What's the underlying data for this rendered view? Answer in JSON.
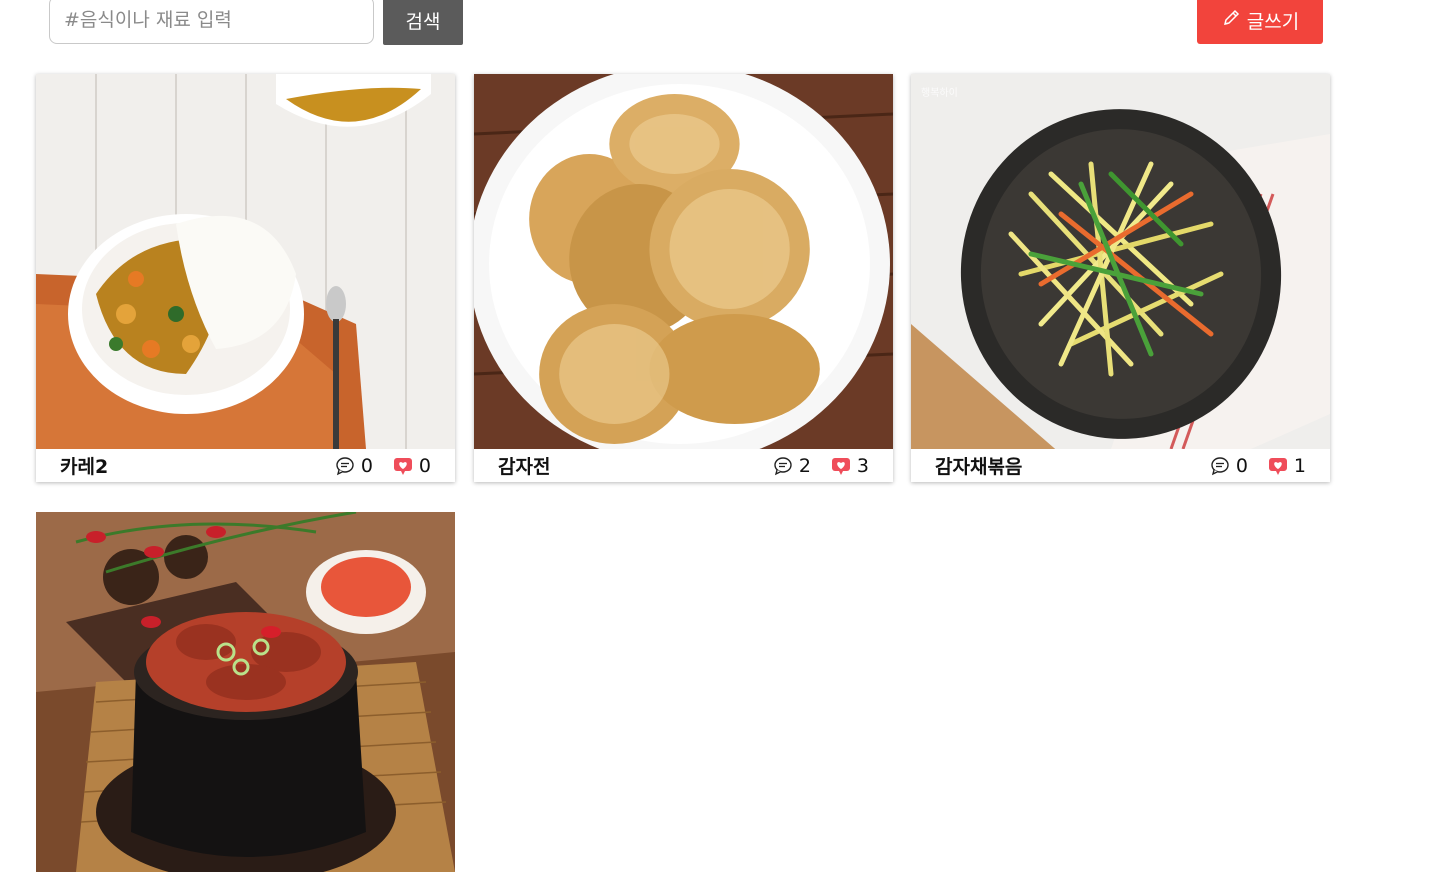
{
  "search": {
    "placeholder": "#음식이나 재료 입력",
    "button_label": "검색"
  },
  "write": {
    "label": "글쓰기",
    "color": "#f2443c"
  },
  "cards": [
    {
      "title": "카레2",
      "comments": "0",
      "likes": "0",
      "image": "curry-rice-photo"
    },
    {
      "title": "감자전",
      "comments": "2",
      "likes": "3",
      "image": "potato-pancake-photo"
    },
    {
      "title": "감자채볶음",
      "comments": "0",
      "likes": "1",
      "image": "stir-fried-potato-photo"
    },
    {
      "title": "",
      "comments": "",
      "likes": "",
      "image": "braised-kimchi-pot-photo"
    }
  ],
  "icons": {
    "comment": "comment-icon",
    "like": "heart-icon",
    "write": "pencil-icon"
  }
}
